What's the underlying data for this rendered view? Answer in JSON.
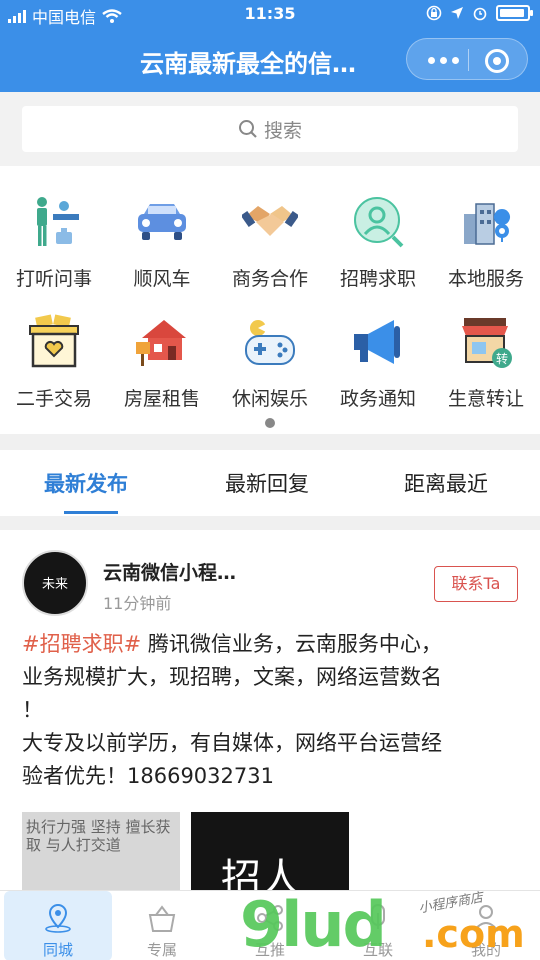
{
  "status": {
    "carrier": "中国电信",
    "time": "11:35"
  },
  "header": {
    "title": "云南最新最全的信…"
  },
  "search": {
    "placeholder": "搜索"
  },
  "grid": [
    {
      "label": "打听问事",
      "icon": "people-help-icon"
    },
    {
      "label": "顺风车",
      "icon": "car-icon"
    },
    {
      "label": "商务合作",
      "icon": "handshake-icon"
    },
    {
      "label": "招聘求职",
      "icon": "person-search-icon"
    },
    {
      "label": "本地服务",
      "icon": "city-location-icon"
    },
    {
      "label": "二手交易",
      "icon": "box-heart-icon"
    },
    {
      "label": "房屋租售",
      "icon": "house-icon"
    },
    {
      "label": "休闲娱乐",
      "icon": "gamepad-icon"
    },
    {
      "label": "政务通知",
      "icon": "megaphone-icon"
    },
    {
      "label": "生意转让",
      "icon": "shop-transfer-icon"
    }
  ],
  "tabs": [
    "最新发布",
    "最新回复",
    "距离最近"
  ],
  "post": {
    "avatar_text": "未来",
    "author": "云南微信小程…",
    "time": "11分钟前",
    "contact_label": "联系Ta",
    "tag": "#招聘求职#",
    "text_lines": [
      " 腾讯微信业务，云南服务中心，",
      "业务规模扩大，现招聘，文案，网络运营数名",
      "！",
      "大专及以前学历，有自媒体，网络平台运营经",
      "验者优先！18669032731"
    ],
    "image1_text": "执行力强 坚持 擅长获取 与人打交道",
    "image2_text": "招人"
  },
  "bottom_nav": [
    {
      "label": "同城",
      "icon": "location-icon",
      "active": true
    },
    {
      "label": "专属",
      "icon": "basket-icon",
      "active": false
    },
    {
      "label": "互推",
      "icon": "share-icon",
      "active": false
    },
    {
      "label": "互联",
      "icon": "link-icon",
      "active": false
    },
    {
      "label": "我的",
      "icon": "user-icon",
      "active": false
    }
  ],
  "watermark": {
    "main": "9lud",
    "suffix": ".com",
    "small": "小程序商店"
  },
  "colors": {
    "header_blue": "#3b8fe8",
    "accent_blue": "#2f7fd6",
    "tag_red": "#e0604a"
  }
}
